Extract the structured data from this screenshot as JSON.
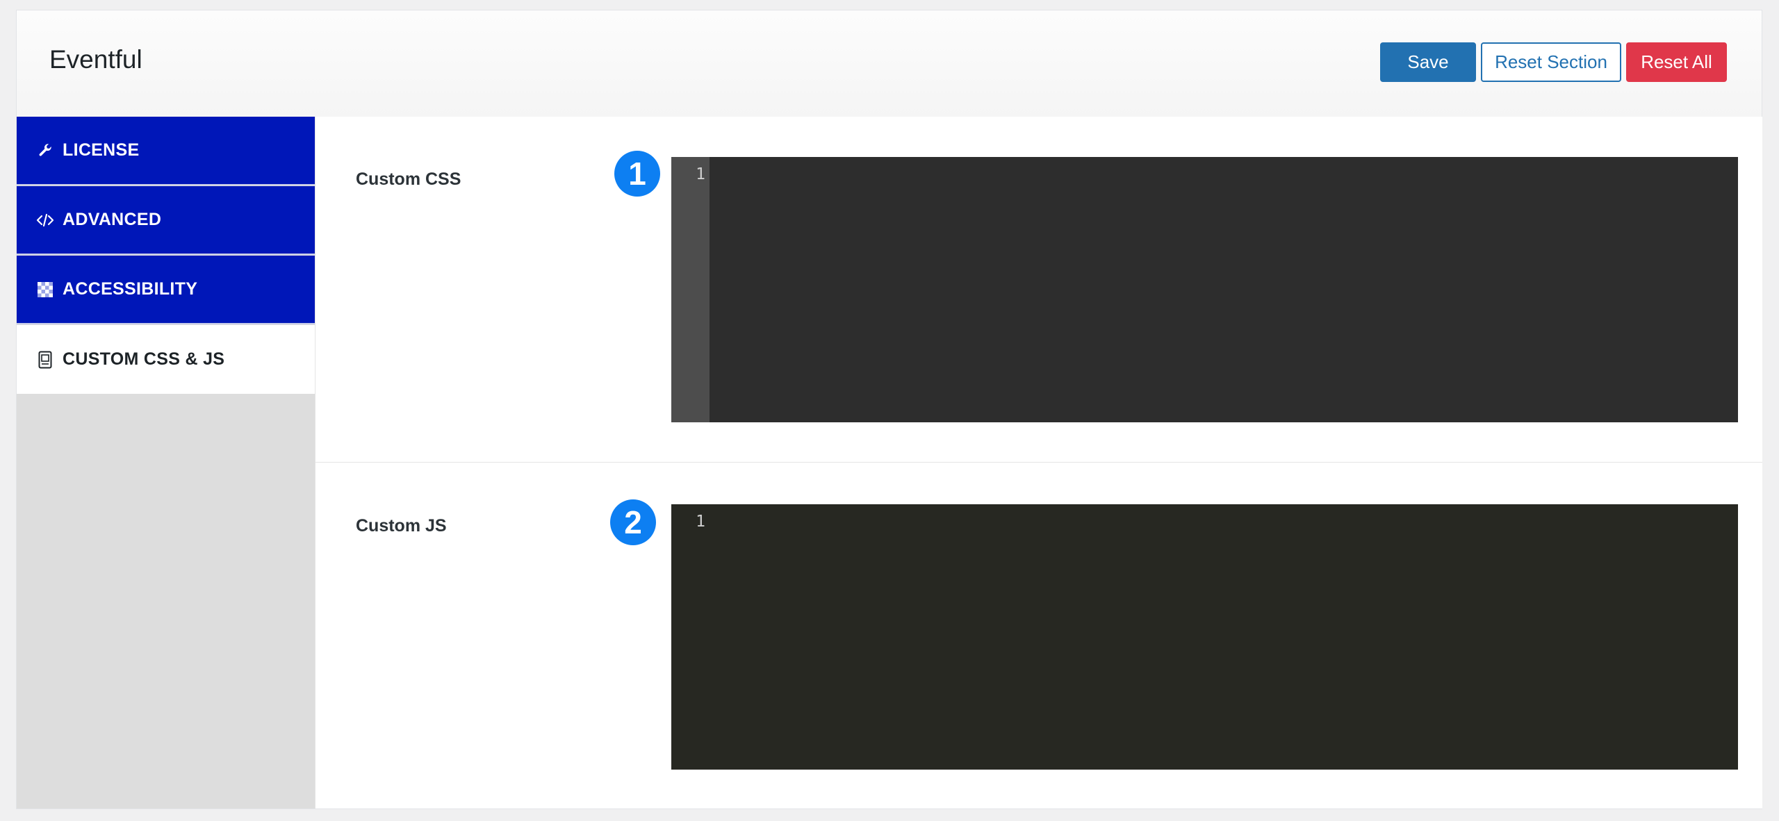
{
  "header": {
    "title": "Eventful",
    "buttons": {
      "save": "Save",
      "reset_section": "Reset Section",
      "reset_all": "Reset All"
    }
  },
  "sidebar": {
    "items": [
      {
        "label": "LICENSE",
        "icon": "wrench-icon"
      },
      {
        "label": "ADVANCED",
        "icon": "code-icon"
      },
      {
        "label": "ACCESSIBILITY",
        "icon": "checkerboard-icon"
      },
      {
        "label": "CUSTOM CSS & JS",
        "icon": "file-code-icon",
        "active": true
      }
    ]
  },
  "fields": {
    "css": {
      "label": "Custom CSS",
      "badge": "1",
      "line_number": "1"
    },
    "js": {
      "label": "Custom JS",
      "badge": "2",
      "line_number": "1"
    }
  },
  "colors": {
    "sidebar_active_bg": "#0017b8",
    "save_button": "#2271b1",
    "reset_all_button": "#e0374a",
    "badge": "#0d7ff2",
    "css_editor_bg": "#2d2d2d",
    "css_gutter_bg": "#4d4d4d",
    "js_editor_bg": "#272822"
  }
}
